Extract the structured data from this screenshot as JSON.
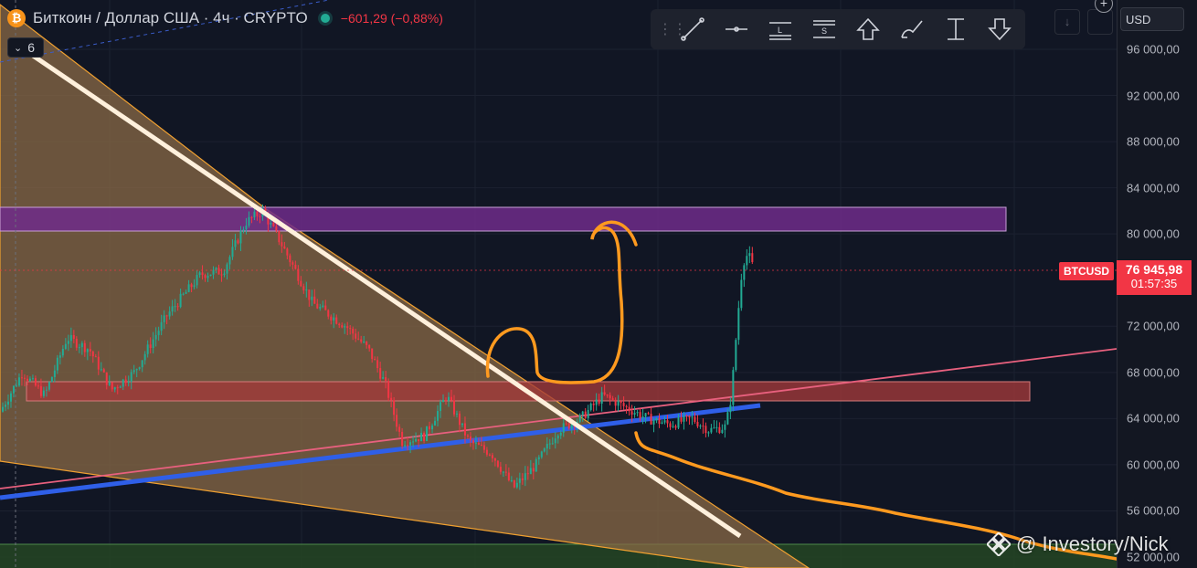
{
  "header": {
    "symbol_title": "Биткоин / Доллар США · 4ч · CRYPTO",
    "change": "−601,29 (−0,88%)",
    "logo_glyph": "₿"
  },
  "indicator_toggle": {
    "count": "6"
  },
  "toolbar": {
    "tools": [
      {
        "icon": "trend-line-icon"
      },
      {
        "icon": "horizontal-line-icon"
      },
      {
        "icon": "long-position-icon",
        "letter": "L"
      },
      {
        "icon": "short-position-icon",
        "letter": "S"
      },
      {
        "icon": "arrow-up-icon"
      },
      {
        "icon": "brush-icon"
      },
      {
        "icon": "price-range-icon"
      },
      {
        "icon": "arrow-down-icon"
      }
    ]
  },
  "currency_selector": {
    "value": "USD"
  },
  "last_price": {
    "symbol": "BTCUSD",
    "price": "76 945,98",
    "countdown": "01:57:35",
    "color": "#f23645"
  },
  "watermark": {
    "text": "@ Investory/Nick"
  },
  "colors": {
    "background": "#111624",
    "up_candle": "#22ab94",
    "down_candle": "#f23645",
    "resistance_zone": "#6e2b8a",
    "support_zone": "#a33a3a",
    "triangle_fill": "#8a6a45",
    "trend_line_white": "#fff0dc",
    "support_trend_blue": "#2f5fe8",
    "pink_line": "#e8607e",
    "hand_drawn": "#ff9a1f"
  },
  "chart_data": {
    "type": "candlestick",
    "symbol": "BTCUSD",
    "timeframe": "4h",
    "ylim": [
      50000,
      98000
    ],
    "y_ticks": [
      {
        "value": 96000,
        "label": "96 000,00"
      },
      {
        "value": 92000,
        "label": "92 000,00"
      },
      {
        "value": 88000,
        "label": "88 000,00"
      },
      {
        "value": 84000,
        "label": "84 000,00"
      },
      {
        "value": 80000,
        "label": "80 000,00"
      },
      {
        "value": 72000,
        "label": "72 000,00"
      },
      {
        "value": 68000,
        "label": "68 000,00"
      },
      {
        "value": 64000,
        "label": "64 000,00"
      },
      {
        "value": 60000,
        "label": "60 000,00"
      },
      {
        "value": 56000,
        "label": "56 000,00"
      },
      {
        "value": 52000,
        "label": "52 000,00"
      }
    ],
    "last_price": 76945.98,
    "price_path": [
      [
        0,
        64600
      ],
      [
        0.02,
        68000
      ],
      [
        0.04,
        66000
      ],
      [
        0.06,
        71000
      ],
      [
        0.08,
        70000
      ],
      [
        0.1,
        66500
      ],
      [
        0.12,
        68000
      ],
      [
        0.15,
        73000
      ],
      [
        0.18,
        76500
      ],
      [
        0.2,
        76800
      ],
      [
        0.22,
        81000
      ],
      [
        0.235,
        82000
      ],
      [
        0.25,
        79500
      ],
      [
        0.28,
        74000
      ],
      [
        0.31,
        72000
      ],
      [
        0.33,
        70000
      ],
      [
        0.345,
        67000
      ],
      [
        0.36,
        62000
      ],
      [
        0.38,
        62500
      ],
      [
        0.4,
        66000
      ],
      [
        0.42,
        62000
      ],
      [
        0.44,
        61000
      ],
      [
        0.46,
        58000
      ],
      [
        0.48,
        60000
      ],
      [
        0.5,
        63000
      ],
      [
        0.52,
        64000
      ],
      [
        0.54,
        66000
      ],
      [
        0.56,
        65000
      ],
      [
        0.58,
        64000
      ],
      [
        0.6,
        63500
      ],
      [
        0.62,
        64000
      ],
      [
        0.635,
        63000
      ],
      [
        0.65,
        63300
      ],
      [
        0.655,
        66000
      ],
      [
        0.66,
        72000
      ],
      [
        0.665,
        77500
      ],
      [
        0.67,
        78300
      ],
      [
        0.675,
        76945.98
      ]
    ],
    "zones": [
      {
        "name": "resistance-zone",
        "from": 80200,
        "to": 82300
      },
      {
        "name": "support-zone",
        "from": 65500,
        "to": 67000
      },
      {
        "name": "bottom-zone",
        "from": 50000,
        "to": 52100
      }
    ]
  }
}
